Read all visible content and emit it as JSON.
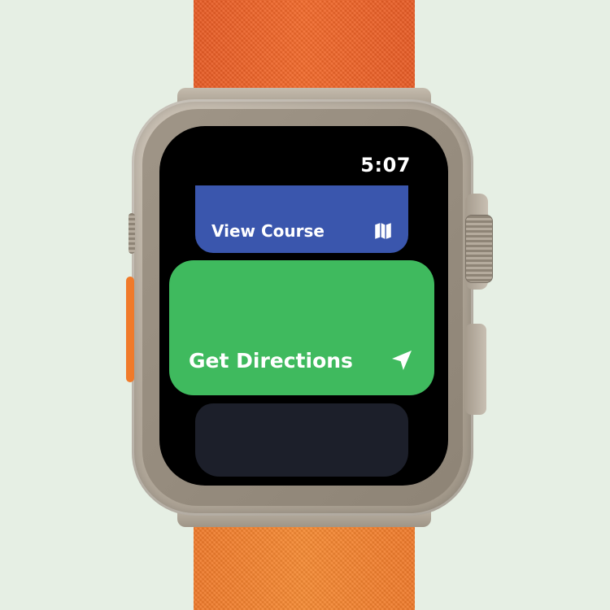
{
  "status_bar": {
    "time": "5:07"
  },
  "cards": {
    "course": {
      "label": "View Course",
      "icon": "map-icon",
      "color": "#3a56ad"
    },
    "directions": {
      "label": "Get Directions",
      "icon": "location-arrow-icon",
      "color": "#3fba5e"
    },
    "next": {
      "color": "#1c1f2a"
    }
  },
  "device": {
    "band_color": "#f06a2a",
    "background": "#e6efe4"
  }
}
